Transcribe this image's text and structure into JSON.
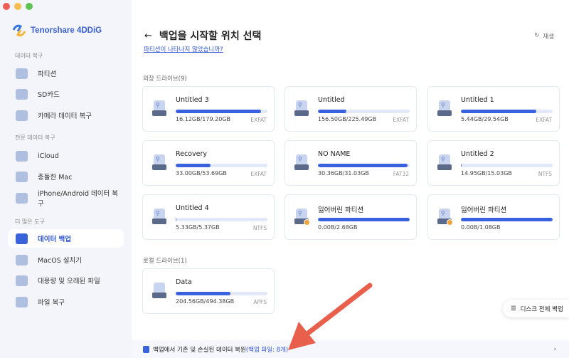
{
  "app": {
    "name": "Tenorshare 4DDiG"
  },
  "sidebar": {
    "sections": [
      {
        "title": "데이터 복구",
        "items": [
          {
            "label": "파티션",
            "icon": "drive-icon"
          },
          {
            "label": "SD카드",
            "icon": "sd-card-icon"
          },
          {
            "label": "카메라 데이터 복구",
            "icon": "camera-icon"
          }
        ]
      },
      {
        "title": "전문 데이터 복구",
        "items": [
          {
            "label": "iCloud",
            "icon": "cloud-icon"
          },
          {
            "label": "충돌한 Mac",
            "icon": "crashed-mac-icon"
          },
          {
            "label": "iPhone/Android 데이터 복구",
            "icon": "phone-icon"
          }
        ]
      },
      {
        "title": "더 많은 도구",
        "items": [
          {
            "label": "데이터 백업",
            "icon": "backup-icon",
            "active": true
          },
          {
            "label": "MacOS 설치기",
            "icon": "apple-icon"
          },
          {
            "label": "대용량 및 오래된 파일",
            "icon": "file-icon"
          },
          {
            "label": "파일 복구",
            "icon": "file-repair-icon"
          }
        ]
      }
    ]
  },
  "main": {
    "title": "백업을 시작할 위치 선택",
    "link": "파티션이 나타나지 않았습니까?",
    "refresh": "재생",
    "external_title": "외장 드라이브(9)",
    "local_title": "로컬 드라이브(1)",
    "external": [
      {
        "name": "Untitled 3",
        "size": "16.12GB/179.20GB",
        "fs": "EXFAT",
        "fill": 0.93
      },
      {
        "name": "Untitled",
        "size": "156.50GB/225.49GB",
        "fs": "EXFAT",
        "fill": 0.31
      },
      {
        "name": "Untitled 1",
        "size": "5.44GB/29.54GB",
        "fs": "EXFAT",
        "fill": 0.82
      },
      {
        "name": "Recovery",
        "size": "33.00GB/53.69GB",
        "fs": "EXFAT",
        "fill": 0.38
      },
      {
        "name": "NO NAME",
        "size": "30.36GB/31.03GB",
        "fs": "FAT32",
        "fill": 0.98
      },
      {
        "name": "Untitled 2",
        "size": "14.95GB/15.03GB",
        "fs": "NTFS",
        "fill": 0.01
      },
      {
        "name": "Untitled 4",
        "size": "5.33GB/5.37GB",
        "fs": "NTFS",
        "fill": 0.01
      },
      {
        "name": "잃어버린 파티션",
        "size": "0.00B/2.68GB",
        "fs": "",
        "fill": 1.0,
        "lost": true
      },
      {
        "name": "잃어버린 파티션",
        "size": "0.00B/1.08GB",
        "fs": "",
        "fill": 1.0,
        "lost": true
      }
    ],
    "local": [
      {
        "name": "Data",
        "size": "204.56GB/494.38GB",
        "fs": "APFS",
        "fill": 0.6
      }
    ],
    "disk_backup": "디스크 전체 백업",
    "bottom_text": "백업에서 기존 및 손실된 데이터 복원",
    "bottom_highlight": "(백업 파일: 8개)"
  },
  "colors": {
    "accent": "#3a62e0",
    "arrow": "#e8604c"
  }
}
